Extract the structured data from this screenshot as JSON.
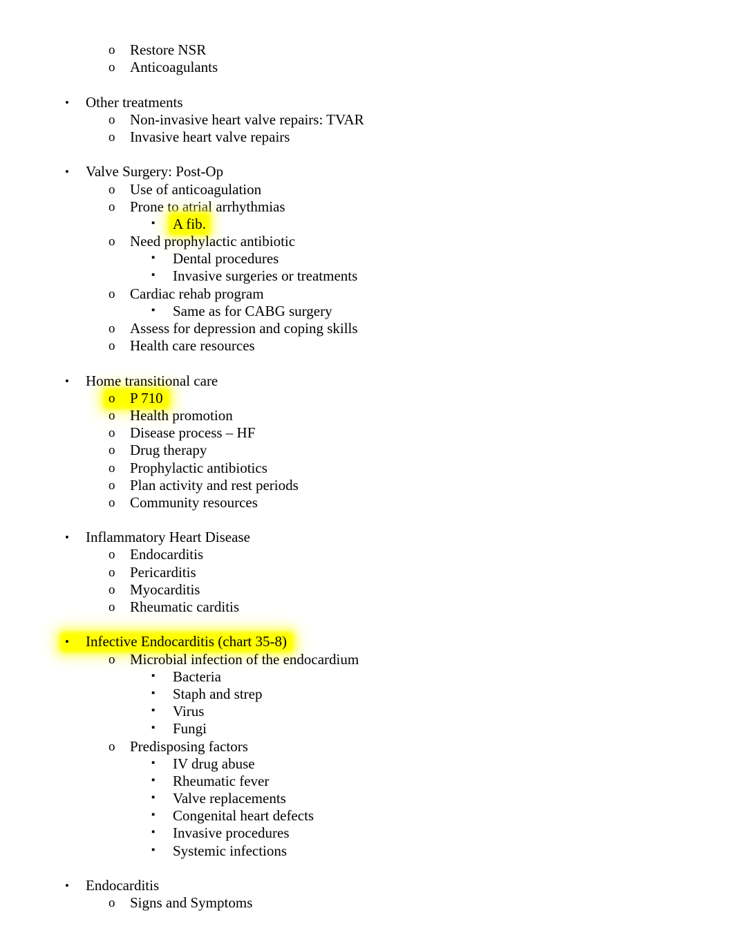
{
  "document": {
    "markers": {
      "level1": "•",
      "level2": "o",
      "level3": "▪"
    },
    "highlight_color": "#ffff00",
    "groups": [
      {
        "id": "group-restore-nsr",
        "items": [
          {
            "level": 2,
            "text": "Restore NSR",
            "highlighted": false
          },
          {
            "level": 2,
            "text": "Anticoagulants",
            "highlighted": false
          }
        ]
      },
      {
        "id": "group-other-treatments",
        "items": [
          {
            "level": 1,
            "text": "Other treatments",
            "highlighted": false
          },
          {
            "level": 2,
            "text": "Non-invasive heart valve repairs: TVAR",
            "highlighted": false
          },
          {
            "level": 2,
            "text": "Invasive heart valve repairs",
            "highlighted": false
          }
        ]
      },
      {
        "id": "group-valve-surgery-post-op",
        "items": [
          {
            "level": 1,
            "text": "Valve Surgery: Post-Op",
            "highlighted": false
          },
          {
            "level": 2,
            "text": "Use of anticoagulation",
            "highlighted": false
          },
          {
            "level": 2,
            "text": "Prone to atrial arrhythmias",
            "highlighted": false
          },
          {
            "level": 3,
            "text": "A fib.",
            "highlighted": true,
            "highlight_includes_marker": false
          },
          {
            "level": 2,
            "text": "Need prophylactic antibiotic",
            "highlighted": false
          },
          {
            "level": 3,
            "text": "Dental procedures",
            "highlighted": false
          },
          {
            "level": 3,
            "text": "Invasive surgeries or treatments",
            "highlighted": false
          },
          {
            "level": 2,
            "text": "Cardiac rehab program",
            "highlighted": false
          },
          {
            "level": 3,
            "text": "Same as for CABG surgery",
            "highlighted": false
          },
          {
            "level": 2,
            "text": "Assess for depression and coping skills",
            "highlighted": false
          },
          {
            "level": 2,
            "text": "Health care resources",
            "highlighted": false
          }
        ]
      },
      {
        "id": "group-home-transitional-care",
        "items": [
          {
            "level": 1,
            "text": "Home transitional care",
            "highlighted": false
          },
          {
            "level": 2,
            "text": "P 710",
            "highlighted": true,
            "highlight_includes_marker": true
          },
          {
            "level": 2,
            "text": "Health promotion",
            "highlighted": false
          },
          {
            "level": 2,
            "text": "Disease process – HF",
            "highlighted": false
          },
          {
            "level": 2,
            "text": "Drug therapy",
            "highlighted": false
          },
          {
            "level": 2,
            "text": "Prophylactic antibiotics",
            "highlighted": false
          },
          {
            "level": 2,
            "text": "Plan activity and rest periods",
            "highlighted": false
          },
          {
            "level": 2,
            "text": "Community resources",
            "highlighted": false
          }
        ]
      },
      {
        "id": "group-inflammatory-heart-disease",
        "items": [
          {
            "level": 1,
            "text": "Inflammatory Heart Disease",
            "highlighted": false
          },
          {
            "level": 2,
            "text": "Endocarditis",
            "highlighted": false
          },
          {
            "level": 2,
            "text": "Pericarditis",
            "highlighted": false
          },
          {
            "level": 2,
            "text": "Myocarditis",
            "highlighted": false
          },
          {
            "level": 2,
            "text": "Rheumatic carditis",
            "highlighted": false
          }
        ]
      },
      {
        "id": "group-infective-endocarditis",
        "items": [
          {
            "level": 1,
            "text": "Infective Endocarditis (chart 35-8)",
            "highlighted": true,
            "highlight_includes_marker": true
          },
          {
            "level": 2,
            "text": "Microbial infection of the endocardium",
            "highlighted": false
          },
          {
            "level": 3,
            "text": "Bacteria",
            "highlighted": false
          },
          {
            "level": 3,
            "text": "Staph and strep",
            "highlighted": false
          },
          {
            "level": 3,
            "text": "Virus",
            "highlighted": false
          },
          {
            "level": 3,
            "text": "Fungi",
            "highlighted": false
          },
          {
            "level": 2,
            "text": "Predisposing factors",
            "highlighted": false
          },
          {
            "level": 3,
            "text": "IV drug abuse",
            "highlighted": false
          },
          {
            "level": 3,
            "text": "Rheumatic fever",
            "highlighted": false
          },
          {
            "level": 3,
            "text": "Valve replacements",
            "highlighted": false
          },
          {
            "level": 3,
            "text": "Congenital heart defects",
            "highlighted": false
          },
          {
            "level": 3,
            "text": "Invasive procedures",
            "highlighted": false
          },
          {
            "level": 3,
            "text": "Systemic infections",
            "highlighted": false
          }
        ]
      },
      {
        "id": "group-endocarditis",
        "items": [
          {
            "level": 1,
            "text": "Endocarditis",
            "highlighted": false
          },
          {
            "level": 2,
            "text": "Signs and Symptoms",
            "highlighted": false
          }
        ]
      }
    ]
  }
}
